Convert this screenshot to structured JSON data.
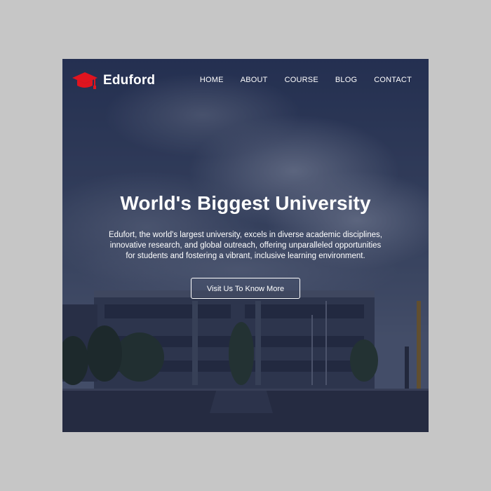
{
  "brand": {
    "name": "Eduford",
    "icon": "graduation-cap-icon",
    "icon_color": "#e0141f"
  },
  "nav": {
    "items": [
      {
        "label": "HOME"
      },
      {
        "label": "ABOUT"
      },
      {
        "label": "COURSE"
      },
      {
        "label": "BLOG"
      },
      {
        "label": "CONTACT"
      }
    ]
  },
  "hero": {
    "title": "World's Biggest University",
    "description": "Edufort, the world's largest university, excels in diverse academic disciplines, innovative research, and global outreach, offering unparalleled opportunities for students and fostering a vibrant, inclusive learning environment.",
    "cta_label": "Visit Us To Know More"
  },
  "colors": {
    "page_background": "#c6c6c6",
    "overlay_tint": "#141e3c",
    "text": "#ffffff",
    "accent": "#e0141f"
  }
}
